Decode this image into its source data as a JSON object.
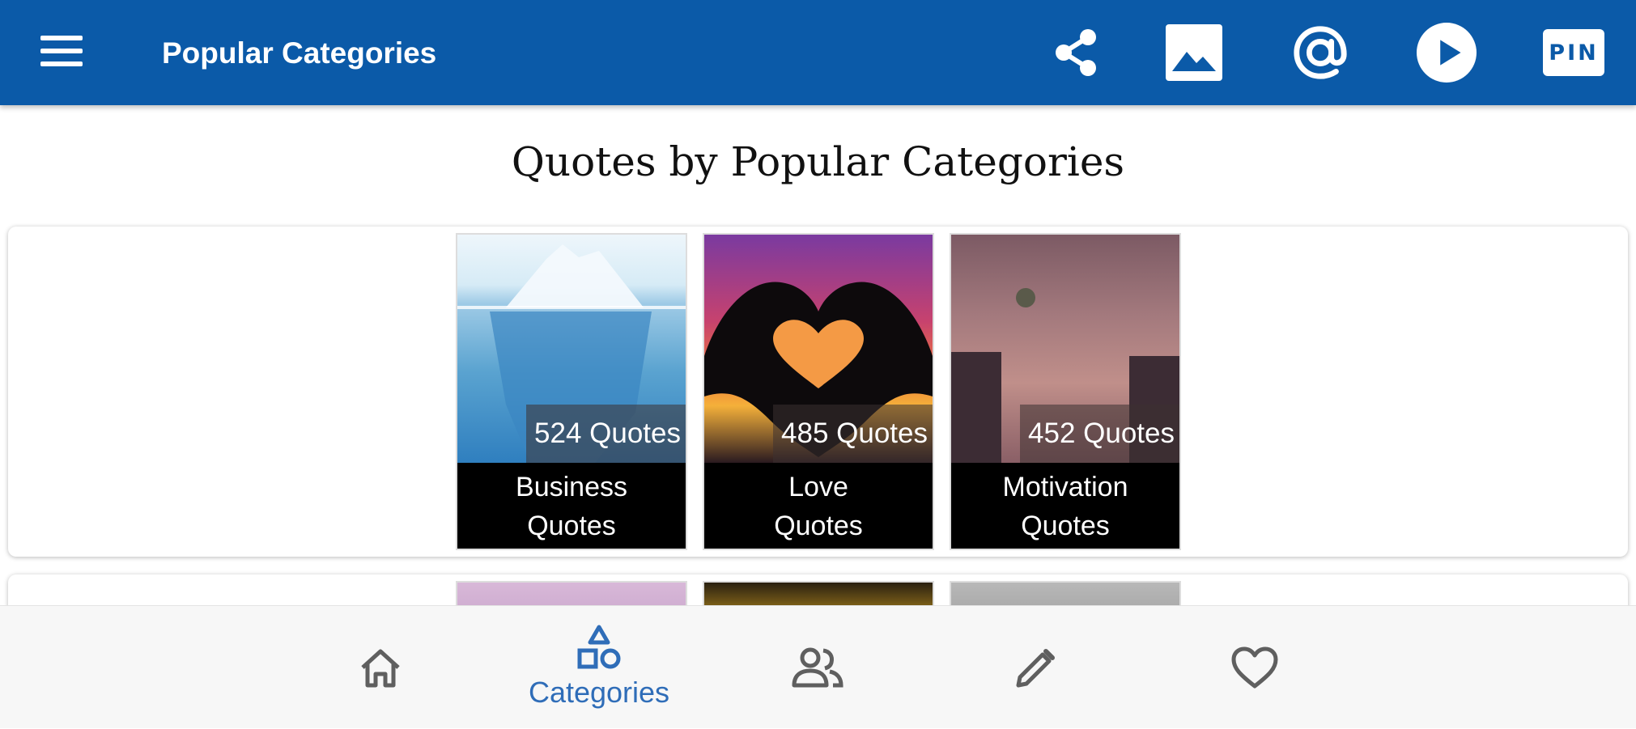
{
  "app_bar": {
    "title": "Popular Categories",
    "background": "#0b5aa8",
    "actions": [
      {
        "icon": "share-icon"
      },
      {
        "icon": "image-icon"
      },
      {
        "icon": "at-sign-icon"
      },
      {
        "icon": "play-icon"
      },
      {
        "icon": "pin-icon",
        "label": "PIN"
      }
    ]
  },
  "heading": "Quotes by Popular Categories",
  "categories": [
    {
      "name_line1": "Business",
      "name_line2": "Quotes",
      "count": "524 Quotes"
    },
    {
      "name_line1": "Love",
      "name_line2": "Quotes",
      "count": "485 Quotes"
    },
    {
      "name_line1": "Motivation",
      "name_line2": "Quotes",
      "count": "452 Quotes"
    }
  ],
  "bottom_nav": {
    "active_color": "#2f6db8",
    "inactive_color": "#5f5f5f",
    "items": [
      {
        "icon": "home-icon",
        "label": ""
      },
      {
        "icon": "categories-icon",
        "label": "Categories",
        "active": true
      },
      {
        "icon": "people-icon",
        "label": ""
      },
      {
        "icon": "pencil-icon",
        "label": ""
      },
      {
        "icon": "heart-icon",
        "label": ""
      }
    ]
  }
}
